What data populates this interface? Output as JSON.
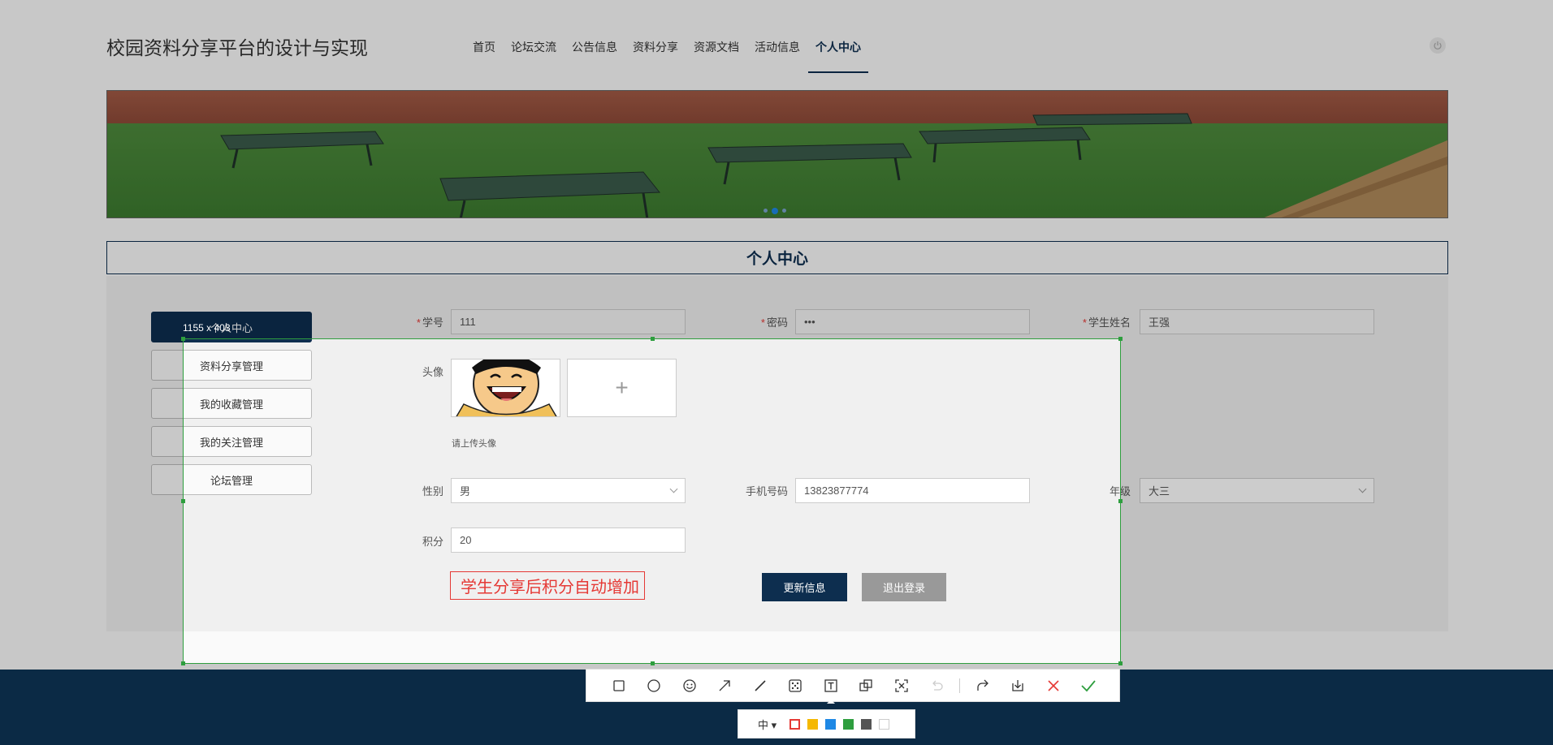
{
  "site": {
    "title": "校园资料分享平台的设计与实现"
  },
  "nav": {
    "items": [
      "首页",
      "论坛交流",
      "公告信息",
      "资料分享",
      "资源文档",
      "活动信息",
      "个人中心"
    ],
    "active": "个人中心"
  },
  "icons": {
    "power": "power-icon",
    "plus": "plus-icon",
    "chevron": "chevron-down-icon"
  },
  "section": {
    "title": "个人中心"
  },
  "sidebar": {
    "items": [
      {
        "label": "个人中心"
      },
      {
        "label": "资料分享管理"
      },
      {
        "label": "我的收藏管理"
      },
      {
        "label": "我的关注管理"
      },
      {
        "label": "论坛管理"
      }
    ]
  },
  "form": {
    "student_id": {
      "label": "学号",
      "required": "*",
      "value": "111"
    },
    "password": {
      "label": "密码",
      "required": "*",
      "value": "•••"
    },
    "student_name": {
      "label": "学生姓名",
      "required": "*",
      "value": "王强"
    },
    "avatar": {
      "label": "头像",
      "hint": "请上传头像",
      "upload_symbol": "+"
    },
    "gender": {
      "label": "性别",
      "value": "男"
    },
    "phone": {
      "label": "手机号码",
      "value": "13823877774"
    },
    "grade": {
      "label": "年级",
      "value": "大三"
    },
    "points": {
      "label": "积分",
      "value": "20"
    },
    "update_button": "更新信息",
    "logout_button": "退出登录"
  },
  "screenshot_tool": {
    "selection_size": "1155 x 403",
    "annotation_text": "学生分享后积分自动增加",
    "tools": [
      "rectangle-icon",
      "circle-icon",
      "emoji-icon",
      "arrow-icon",
      "line-icon",
      "mosaic-icon",
      "text-icon",
      "copy-icon",
      "ocr-icon",
      "undo-icon",
      "share-icon",
      "download-icon",
      "cancel-icon",
      "confirm-icon"
    ],
    "font_size": "中",
    "colors": [
      "#e53935",
      "#f5b800",
      "#1e88e5",
      "#2e9e3e",
      "#555555",
      "#ffffff"
    ],
    "selected_color": "#e53935"
  }
}
